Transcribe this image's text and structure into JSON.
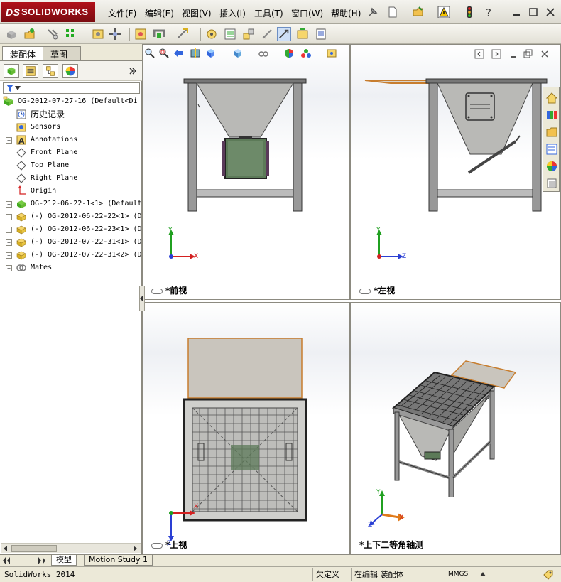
{
  "app": {
    "brand": "SOLIDWORKS",
    "brand_prefix": "DS"
  },
  "menu": [
    "文件(F)",
    "编辑(E)",
    "视图(V)",
    "插入(I)",
    "工具(T)",
    "窗口(W)",
    "帮助(H)"
  ],
  "panel_tabs": {
    "assembly": "装配体",
    "sketch": "草图"
  },
  "tree": [
    {
      "label": "OG-2012-07-27-16  (Default<Di",
      "icon": "assembly-icon",
      "indent": 0,
      "expander": "none"
    },
    {
      "label": "历史记录",
      "icon": "history-icon",
      "indent": 1,
      "expander": "none",
      "cjk": true
    },
    {
      "label": "Sensors",
      "icon": "sensor-icon",
      "indent": 1,
      "expander": "none"
    },
    {
      "label": "Annotations",
      "icon": "annotation-icon",
      "indent": 1,
      "expander": "plus"
    },
    {
      "label": "Front Plane",
      "icon": "plane-icon",
      "indent": 1,
      "expander": "none"
    },
    {
      "label": "Top Plane",
      "icon": "plane-icon",
      "indent": 1,
      "expander": "none"
    },
    {
      "label": "Right Plane",
      "icon": "plane-icon",
      "indent": 1,
      "expander": "none"
    },
    {
      "label": "Origin",
      "icon": "origin-icon",
      "indent": 1,
      "expander": "none"
    },
    {
      "label": "OG-212-06-22-1<1> (Default",
      "icon": "subassembly-icon",
      "indent": 1,
      "expander": "plus"
    },
    {
      "label": "(-) OG-2012-06-22-22<1> (D",
      "icon": "part-icon",
      "indent": 1,
      "expander": "plus"
    },
    {
      "label": "(-) OG-2012-06-22-23<1> (D",
      "icon": "part-icon",
      "indent": 1,
      "expander": "plus"
    },
    {
      "label": "(-) OG-2012-07-22-31<1> (D",
      "icon": "part-icon",
      "indent": 1,
      "expander": "plus"
    },
    {
      "label": "(-) OG-2012-07-22-31<2> (D",
      "icon": "part-icon",
      "indent": 1,
      "expander": "plus"
    },
    {
      "label": "Mates",
      "icon": "mates-icon",
      "indent": 1,
      "expander": "plus"
    }
  ],
  "viewports": {
    "front": "*前视",
    "left": "*左视",
    "top": "*上视",
    "iso": "*上下二等角轴测"
  },
  "axes": {
    "x": "X",
    "y": "Y",
    "z": "Z"
  },
  "bottom_tabs": {
    "model": "模型",
    "motion": "Motion Study 1"
  },
  "status": {
    "app_version": "SolidWorks 2014",
    "under_defined": "欠定义",
    "editing": "在编辑 装配体",
    "units": "MMGS"
  },
  "colors": {
    "frame": "#8a8a8a",
    "hopper": "#b9b9b6",
    "panel_green": "#5c7a58",
    "table_top": "#c9c5bd",
    "table_edge": "#c77d2e",
    "axis_x": "#d42020",
    "axis_y": "#20a020",
    "axis_z": "#2a3fd4"
  }
}
